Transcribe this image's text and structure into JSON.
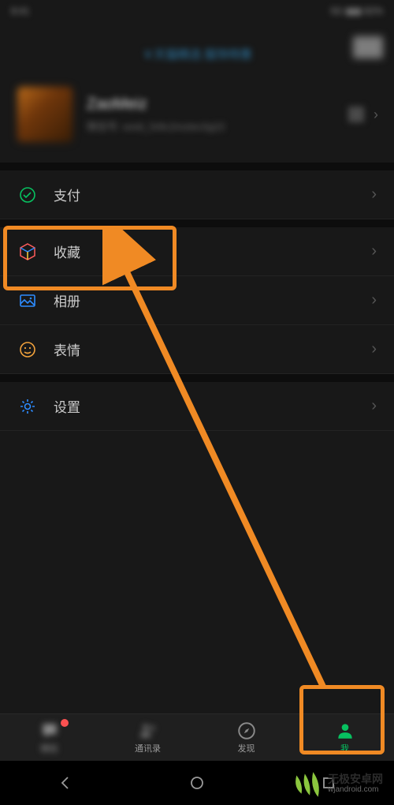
{
  "status": {
    "left": "8:41",
    "right": "5G ▮▮▮ 82%"
  },
  "notice": {
    "center": "￥天猫精选 服饰特惠"
  },
  "profile": {
    "name": "ZaoMeiz",
    "sub": "微信号: wxid_5r8c2mztec0g22"
  },
  "menu": {
    "pay": {
      "label": "支付"
    },
    "fav": {
      "label": "收藏"
    },
    "album": {
      "label": "相册"
    },
    "emoji": {
      "label": "表情"
    },
    "settings": {
      "label": "设置"
    }
  },
  "tabs": {
    "chat": {
      "label": "微信"
    },
    "contact": {
      "label": "通讯录"
    },
    "discover": {
      "label": "发现"
    },
    "me": {
      "label": "我"
    }
  },
  "watermark": {
    "line1": "无极安卓网",
    "line2": "wjandroid.com"
  }
}
